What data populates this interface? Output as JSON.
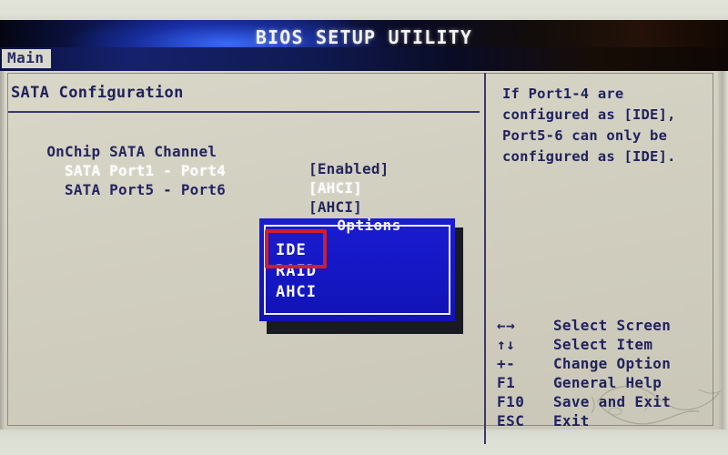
{
  "window": {
    "title": "BIOS SETUP UTILITY"
  },
  "menu": {
    "tabs": [
      {
        "label": "Main",
        "active": true
      }
    ]
  },
  "settings_panel": {
    "section_title": "SATA Configuration",
    "rows": [
      {
        "label": "OnChip SATA Channel",
        "value": "[Enabled]",
        "selected": false
      },
      {
        "label": "  SATA Port1 - Port4",
        "value": "[AHCI]",
        "selected": true
      },
      {
        "label": "  SATA Port5 - Port6",
        "value": "[AHCI]",
        "selected": false
      }
    ]
  },
  "options_dialog": {
    "title": "Options",
    "items": [
      {
        "label": "IDE",
        "annotated": true
      },
      {
        "label": "RAID",
        "annotated": false
      },
      {
        "label": "AHCI",
        "annotated": false
      }
    ]
  },
  "help_panel": {
    "text": "If Port1-4 are\nconfigured as [IDE],\nPort5-6 can only be\nconfigured as [IDE]."
  },
  "nav_legend": [
    {
      "key": "←→",
      "desc": "Select Screen"
    },
    {
      "key": "↑↓",
      "desc": "Select Item"
    },
    {
      "key": "+-",
      "desc": "Change Option"
    },
    {
      "key": "F1",
      "desc": "General Help"
    },
    {
      "key": "F10",
      "desc": "Save and Exit"
    },
    {
      "key": "ESC",
      "desc": "Exit"
    }
  ],
  "colors": {
    "screen_background": "#d4d2c3",
    "text_primary": "#21225e",
    "text_selected": "#fdfdfd",
    "dialog_blue": "#1417c8",
    "annotation_red": "#cc1f2f",
    "titlebar_blue": "#132080"
  }
}
